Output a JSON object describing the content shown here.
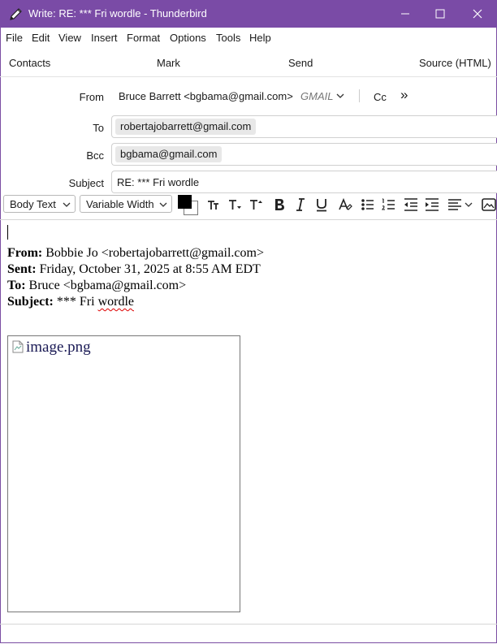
{
  "window": {
    "title": "Write: RE: *** Fri wordle - Thunderbird"
  },
  "menu": {
    "file": "File",
    "edit": "Edit",
    "view": "View",
    "insert": "Insert",
    "format": "Format",
    "options": "Options",
    "tools": "Tools",
    "help": "Help"
  },
  "toolbar": {
    "contacts": "Contacts",
    "mark": "Mark",
    "send": "Send",
    "source": "Source (HTML)"
  },
  "header": {
    "from_label": "From",
    "from_value": "Bruce Barrett <bgbama@gmail.com>",
    "from_account": "GMAIL",
    "cc_label": "Cc",
    "more_label": "»",
    "to_label": "To",
    "to_value": "robertajobarrett@gmail.com",
    "bcc_label": "Bcc",
    "bcc_value": "bgbama@gmail.com",
    "subject_label": "Subject",
    "subject_value": "RE: *** Fri wordle"
  },
  "format": {
    "paragraph": "Body Text",
    "font": "Variable Width",
    "text_color": "#000000",
    "bg_color": "#ffffff"
  },
  "body": {
    "from_key": "From:",
    "from_val": " Bobbie Jo <robertajobarrett@gmail.com>",
    "sent_key": "Sent:",
    "sent_val": " Friday, October 31, 2025 at 8:55 AM EDT",
    "to_key": "To:",
    "to_val": " Bruce <bgbama@gmail.com>",
    "subject_key": "Subject:",
    "subject_pre": " *** Fri ",
    "subject_word": "wordle",
    "image_alt": "image.png"
  },
  "colors": {
    "titlebar": "#7a4ba6",
    "accent": "#7b4ea3"
  }
}
